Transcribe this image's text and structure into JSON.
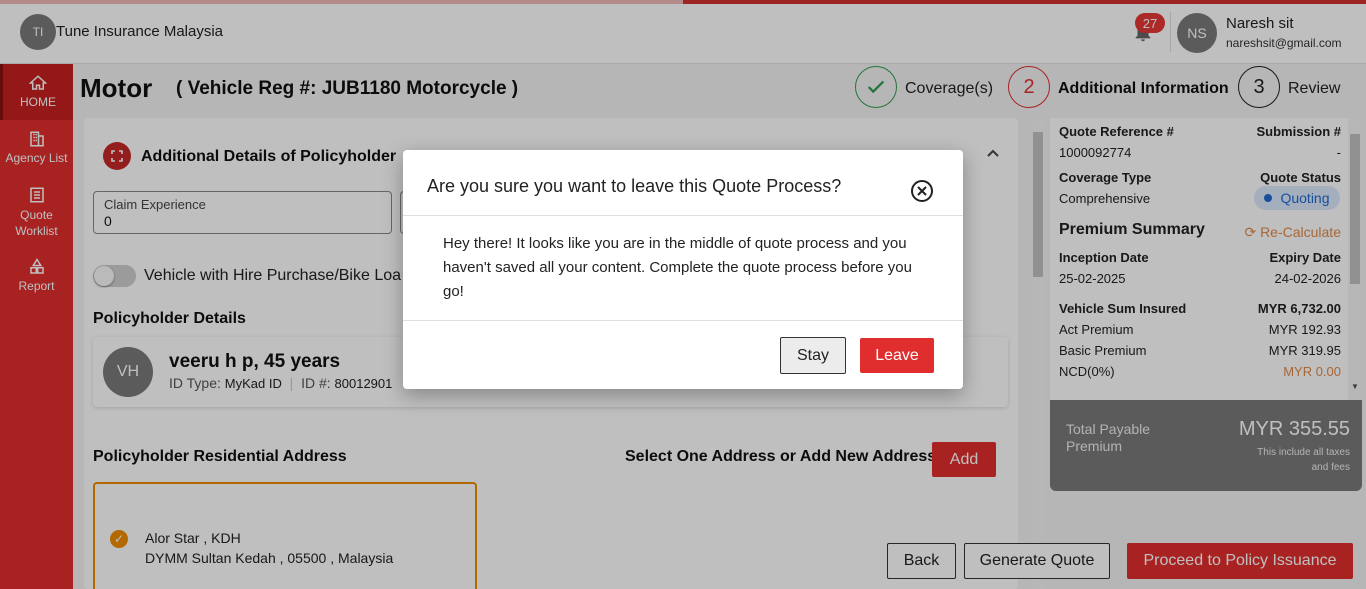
{
  "colors": {
    "accent": "#e02e2e",
    "success": "#2e9e4f",
    "status_blue": "#1f6ad1",
    "selection": "#ef8c00"
  },
  "header": {
    "brand_initials": "TI",
    "brand_name": "Tune Insurance Malaysia",
    "notification_count": "27",
    "user_initials": "NS",
    "user_name": "Naresh sit",
    "user_email": "nareshsit@gmail.com"
  },
  "sidebar": {
    "items": [
      {
        "label": "HOME",
        "icon": "home-icon"
      },
      {
        "label": "Agency List",
        "icon": "building-icon"
      },
      {
        "label": "Quote Worklist",
        "icon": "list-icon"
      },
      {
        "label": "Report",
        "icon": "report-icon"
      }
    ]
  },
  "page": {
    "title": "Motor",
    "subtitle": "( Vehicle Reg #: JUB1180 Motorcycle )"
  },
  "stepper": [
    {
      "number": "",
      "label": "Coverage(s)",
      "state": "done"
    },
    {
      "number": "2",
      "label": "Additional Information",
      "state": "current"
    },
    {
      "number": "3",
      "label": "Review",
      "state": "pending"
    }
  ],
  "form": {
    "section_title": "Additional Details of Policyholder",
    "claim_experience_label": "Claim Experience",
    "claim_experience_value": "0",
    "hire_purchase_label": "Vehicle with Hire Purchase/Bike Loa",
    "policyholder_details_heading": "Policyholder Details",
    "holder_initials": "VH",
    "holder_name": "veeru h p, 45 years",
    "id_type_label": "ID Type:",
    "id_type_value": "MyKad ID",
    "id_no_label": "ID #:",
    "id_no_value": "80012901",
    "address_heading": "Policyholder Residential Address",
    "select_address_label": "Select One Address or Add New Address",
    "add_button": "Add",
    "address_line1": "Alor Star , KDH",
    "address_line2": "DYMM Sultan Kedah , 05500 , Malaysia"
  },
  "summary": {
    "quote_ref_label": "Quote Reference #",
    "quote_ref_value": "1000092774",
    "submission_label": "Submission #",
    "submission_value": "-",
    "coverage_type_label": "Coverage Type",
    "coverage_type_value": "Comprehensive",
    "quote_status_label": "Quote Status",
    "quote_status_value": "Quoting",
    "premium_summary_title": "Premium Summary",
    "recalculate_label": "Re-Calculate",
    "inception_label": "Inception Date",
    "inception_value": "25-02-2025",
    "expiry_label": "Expiry Date",
    "expiry_value": "24-02-2026",
    "sum_insured_label": "Vehicle Sum Insured",
    "sum_insured_value": "MYR 6,732.00",
    "act_premium_label": "Act Premium",
    "act_premium_value": "MYR 192.93",
    "basic_premium_label": "Basic Premium",
    "basic_premium_value": "MYR 319.95",
    "ncd_label": "NCD(0%)",
    "ncd_value": "MYR 0.00",
    "total_label": "Total Payable Premium",
    "total_value": "MYR 355.55",
    "total_note": "This include all taxes and fees"
  },
  "footer_buttons": {
    "back": "Back",
    "generate_quote": "Generate Quote",
    "proceed": "Proceed to Policy Issuance"
  },
  "modal": {
    "title": "Are you sure you want to leave this Quote Process?",
    "body": "Hey there! It looks like you are in the middle of quote process and you haven't saved all your content. Complete the quote process before you go!",
    "stay_button": "Stay",
    "leave_button": "Leave"
  }
}
